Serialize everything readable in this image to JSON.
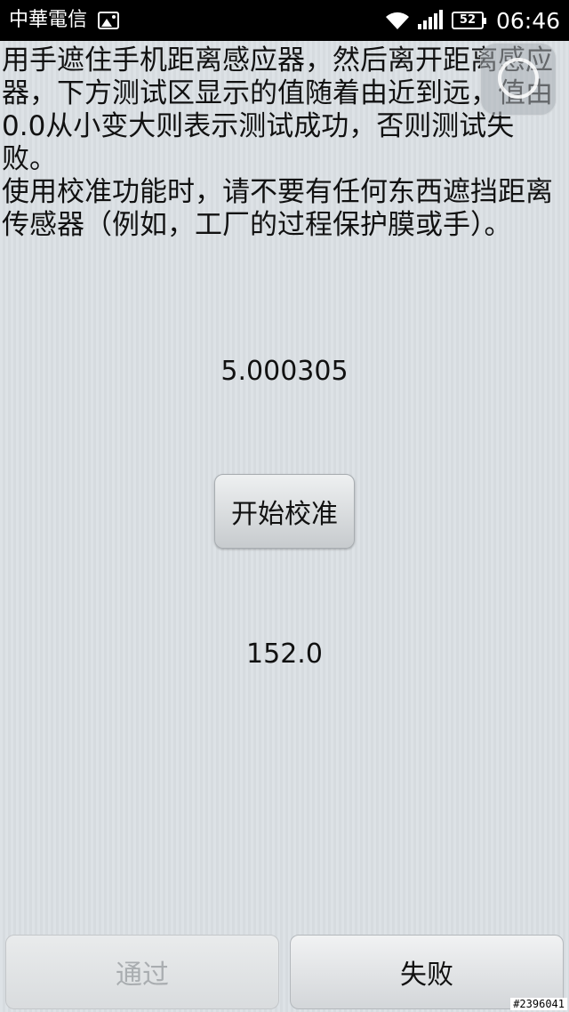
{
  "status_bar": {
    "carrier": "中華電信",
    "battery": "52",
    "time": "06:46",
    "icons": [
      "image-notification-icon",
      "wifi-icon",
      "signal-icon",
      "battery-icon"
    ]
  },
  "instructions": {
    "line1": "用手遮住手机距离感应器，然后离开距离感应器，下方测试区显示的值随着由近到远，值由0.0从小变大则表示测试成功，否则测试失败。",
    "line2": "使用校准功能时，请不要有任何东西遮挡距离传感器（例如，工厂的过程保护膜或手）。"
  },
  "sensor_value": "5.000305",
  "calibrate_button": "开始校准",
  "calibration_value": "152.0",
  "bottom_buttons": {
    "pass": "通过",
    "fail": "失败"
  },
  "watermark": "#2396041"
}
